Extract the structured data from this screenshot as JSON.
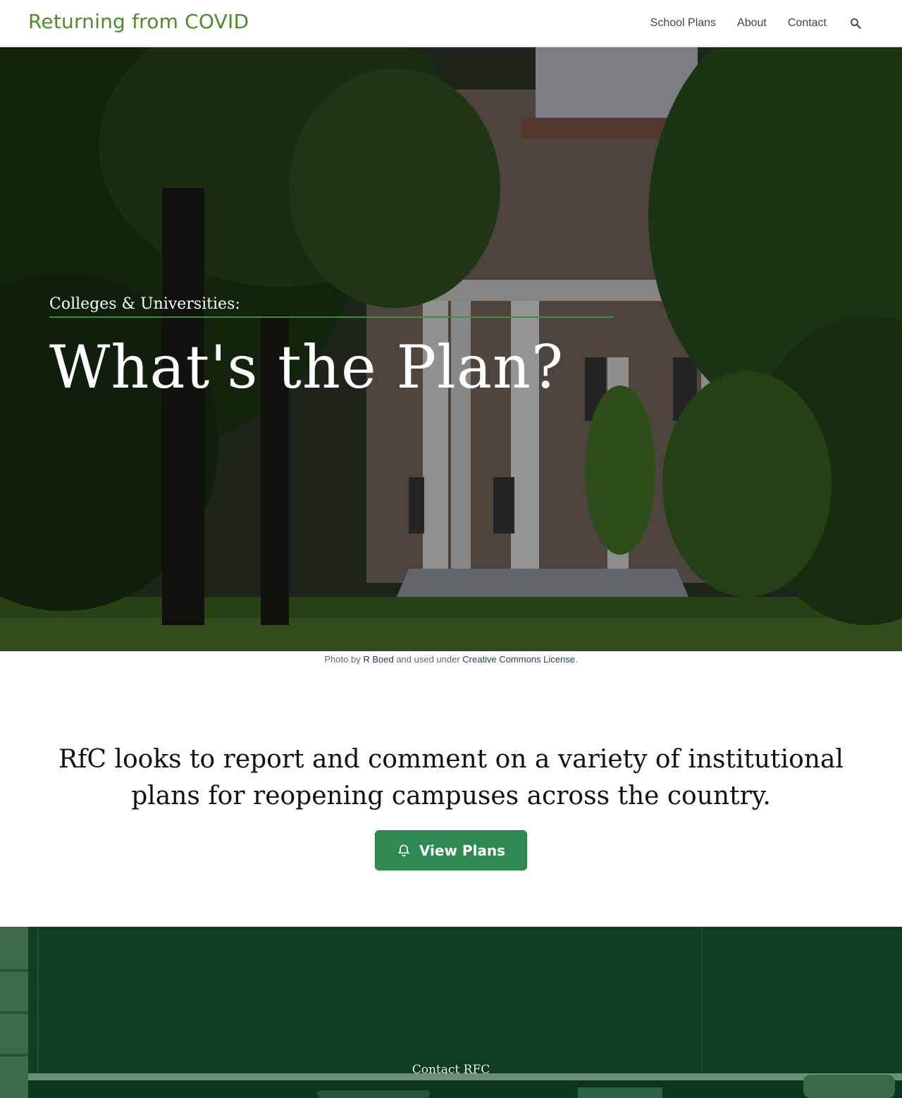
{
  "header": {
    "site_title": "Returning from COVID",
    "nav": [
      "School Plans",
      "About",
      "Contact"
    ],
    "search_icon": "search-icon"
  },
  "hero": {
    "kicker": "Colleges & Universities:",
    "title": "What's the Plan?"
  },
  "caption": {
    "prefix": "Photo by ",
    "author": "R Boed",
    "middle": " and used under ",
    "license": "Creative Commons License",
    "suffix": "."
  },
  "intro": {
    "text": "RfC looks to report and comment on a variety of institutional plans for reopening campuses across the country."
  },
  "cta": {
    "icon": "bell-icon",
    "label": "View Plans"
  },
  "contact": {
    "label": "Contact RFC"
  },
  "colors": {
    "brand": "#4f8a2c",
    "button": "#2e8a52",
    "band": "#0f3d24"
  }
}
